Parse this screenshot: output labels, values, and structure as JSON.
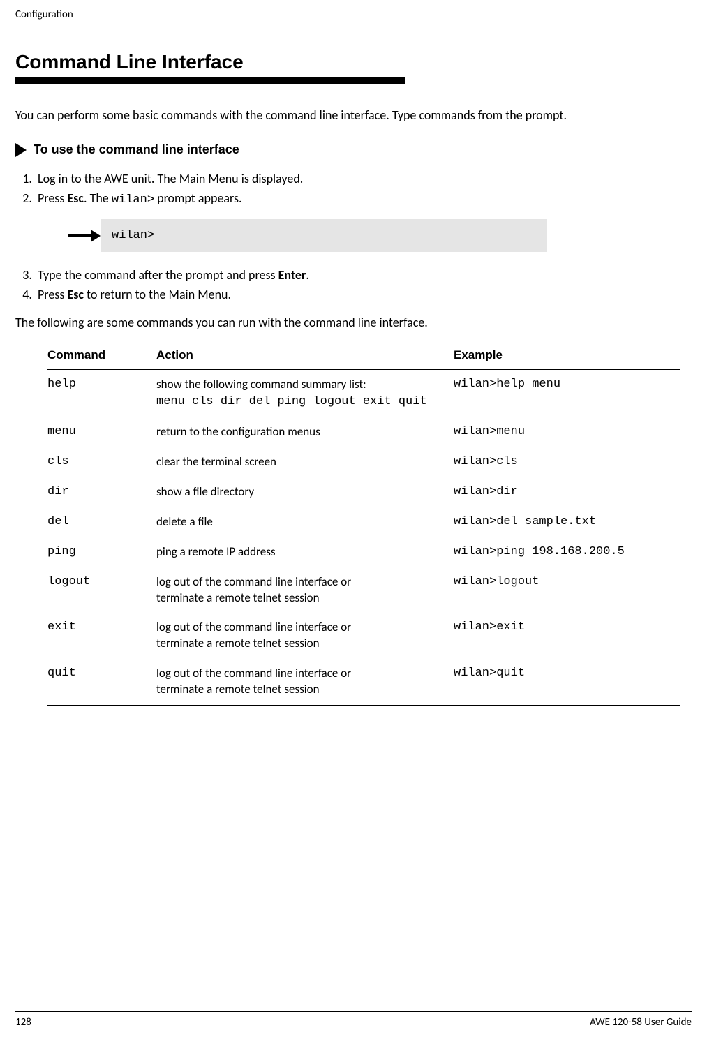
{
  "header": {
    "section": "Configuration"
  },
  "title": "Command Line Interface",
  "intro": "You can perform some basic commands with the command line interface. Type commands from the prompt.",
  "procedure_heading": "To use the command line interface",
  "steps": {
    "s1": "Log in to the AWE unit. The Main Menu is displayed.",
    "s2_pre": "Press ",
    "s2_esc": "Esc",
    "s2_mid": ". The ",
    "s2_prompt": "wilan>",
    "s2_post": " prompt appears.",
    "s3_pre": "Type the command after the prompt and press ",
    "s3_enter": "Enter",
    "s3_post": ".",
    "s4_pre": "Press ",
    "s4_esc": "Esc",
    "s4_post": " to return to the Main Menu."
  },
  "prompt_box": "wilan>",
  "table_intro": "The following are some commands you can run with the command line interface.",
  "table": {
    "headers": {
      "c1": "Command",
      "c2": "Action",
      "c3": "Example"
    },
    "rows": [
      {
        "cmd": "help",
        "action_text": "show the following command summary list:",
        "action_mono": "menu cls dir del ping logout exit quit",
        "example": "wilan>help menu"
      },
      {
        "cmd": "menu",
        "action_text": "return to the configuration menus",
        "example": "wilan>menu"
      },
      {
        "cmd": "cls",
        "action_text": "clear the terminal screen",
        "example": "wilan>cls"
      },
      {
        "cmd": "dir",
        "action_text": "show a file directory",
        "example": "wilan>dir"
      },
      {
        "cmd": "del",
        "action_text": "delete a file",
        "example": "wilan>del sample.txt"
      },
      {
        "cmd": "ping",
        "action_text": "ping a remote IP address",
        "example": "wilan>ping 198.168.200.5"
      },
      {
        "cmd": "logout",
        "action_text": "log out of the command line interface or\nterminate a remote telnet session",
        "example": "wilan>logout"
      },
      {
        "cmd": "exit",
        "action_text": "log out of the command line interface or\nterminate a remote telnet session",
        "example": "wilan>exit"
      },
      {
        "cmd": "quit",
        "action_text": "log out of the command line interface or\nterminate a remote telnet session",
        "example": "wilan>quit"
      }
    ]
  },
  "footer": {
    "page": "128",
    "guide": "AWE 120-58 User Guide"
  }
}
